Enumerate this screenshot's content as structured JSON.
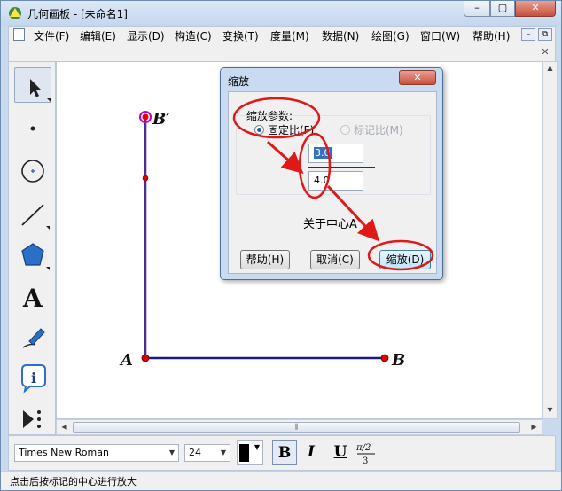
{
  "window": {
    "title": "几何画板 - [未命名1]",
    "minimize": "–",
    "maximize": "▢",
    "close": "✕"
  },
  "menubar": {
    "items": [
      "文件(F)",
      "编辑(E)",
      "显示(D)",
      "构造(C)",
      "变换(T)",
      "度量(M)",
      "数据(N)",
      "绘图(G)",
      "窗口(W)",
      "帮助(H)"
    ],
    "mdi_minimize": "–",
    "mdi_restore": "⧉"
  },
  "document": {
    "close": "✕"
  },
  "toolbox": {
    "tools": [
      "arrow-tool",
      "point-tool",
      "compass-tool",
      "straightedge-tool",
      "polygon-tool",
      "text-tool",
      "marker-tool",
      "information-tool",
      "custom-tool"
    ]
  },
  "canvas": {
    "labels": {
      "a": "A",
      "b": "B",
      "b_prime": "B′"
    },
    "colors": {
      "segment": "#1a1a7a",
      "point": "#e00000",
      "selected_point": "#c000c0"
    }
  },
  "dialog": {
    "title": "缩放",
    "close": "✕",
    "params_label": "缩放参数:",
    "fixed_ratio": "固定比(F)",
    "marked_ratio": "标记比(M)",
    "numerator": "3.0",
    "denominator": "4.0",
    "center_text": "关于中心A",
    "help_button": "帮助(H)",
    "cancel_button": "取消(C)",
    "scale_button": "缩放(D)"
  },
  "formatbar": {
    "font": "Times New Roman",
    "size": "24",
    "bold": "B",
    "italic": "I",
    "underline": "U"
  },
  "status": {
    "text": "点击后按标记的中心进行放大"
  },
  "annotation_color": "#e01818"
}
